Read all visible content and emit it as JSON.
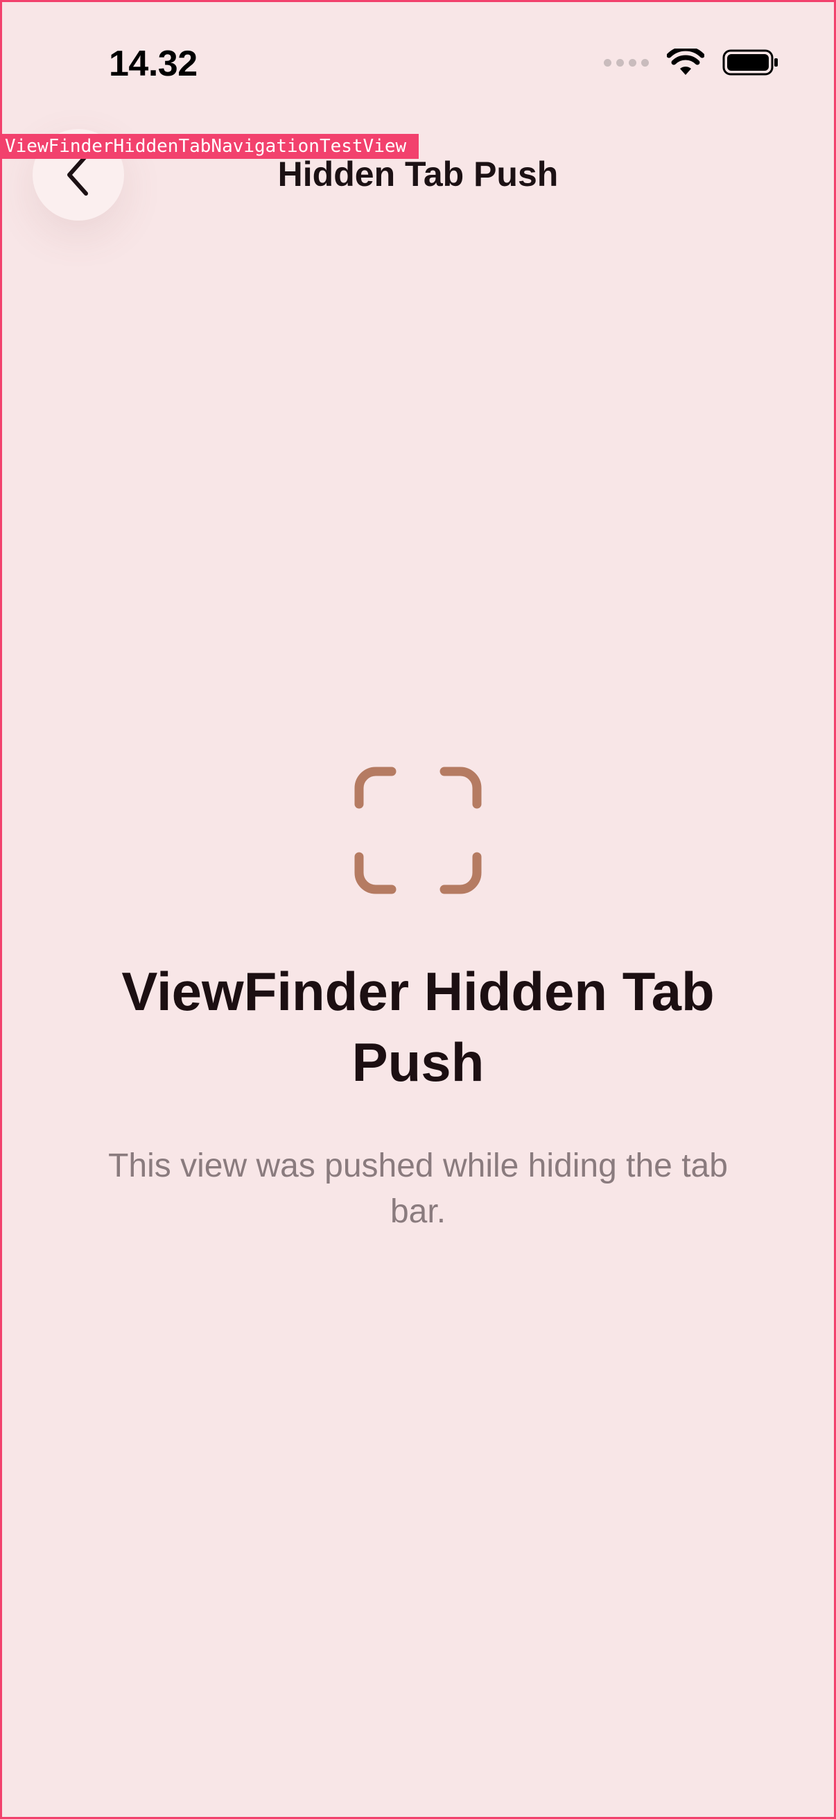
{
  "status_bar": {
    "time": "14.32"
  },
  "debug": {
    "view_name": "ViewFinderHiddenTabNavigationTestView"
  },
  "nav": {
    "title": "Hidden Tab Push",
    "back_icon": "chevron-left-icon"
  },
  "content": {
    "icon": "viewfinder-icon",
    "icon_color": "#b57b62",
    "title": "ViewFinder Hidden Tab Push",
    "subtitle": "This view was pushed while hiding the tab bar."
  },
  "colors": {
    "background": "#f8e6e7",
    "accent": "#f2416d"
  }
}
